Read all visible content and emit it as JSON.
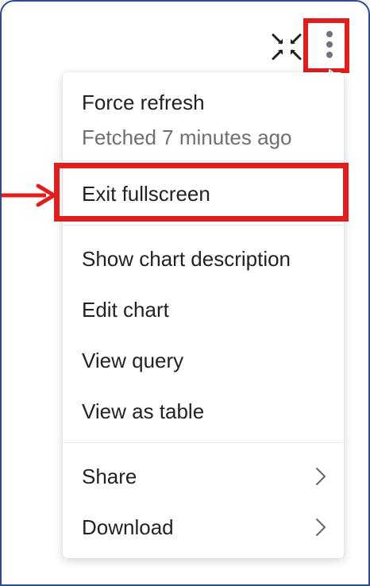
{
  "toolbar": {
    "fullscreen_icon": "exit-fullscreen-icon",
    "more_icon": "vertical-more-icon"
  },
  "menu": {
    "force_refresh": "Force refresh",
    "fetched_status": "Fetched 7 minutes ago",
    "exit_fullscreen": "Exit fullscreen",
    "show_chart_description": "Show chart description",
    "edit_chart": "Edit chart",
    "view_query": "View query",
    "view_as_table": "View as table",
    "share": "Share",
    "download": "Download"
  },
  "colors": {
    "highlight": "#e31c1c",
    "window_border": "#2d4b8e",
    "text_primary": "#222222",
    "text_secondary": "#6f6f6f"
  }
}
